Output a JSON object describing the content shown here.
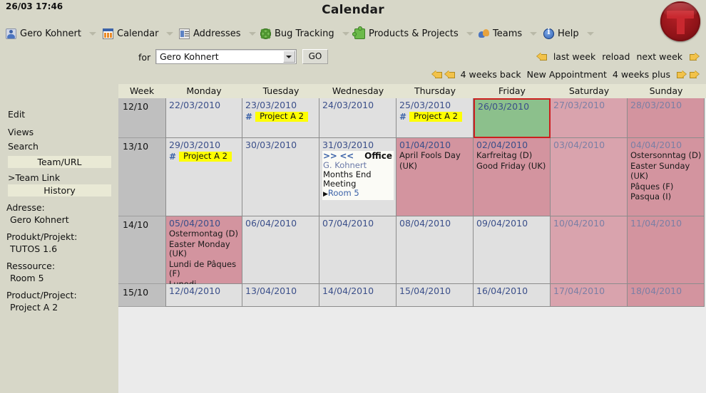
{
  "banner": {
    "clock": "26/03 17:46",
    "title": "Calendar",
    "logo_alt": "tutos-logo"
  },
  "menubar": [
    {
      "label": "Gero Kohnert",
      "icon": "user-icon"
    },
    {
      "label": "Calendar",
      "icon": "calendar-icon"
    },
    {
      "label": "Addresses",
      "icon": "addressbook-icon"
    },
    {
      "label": "Bug Tracking",
      "icon": "bug-icon"
    },
    {
      "label": "Products & Projects",
      "icon": "puzzle-icon"
    },
    {
      "label": "Teams",
      "icon": "team-icon"
    },
    {
      "label": "Help",
      "icon": "info-icon"
    }
  ],
  "sidebar": {
    "links": [
      "Edit",
      "Views",
      "Search"
    ],
    "team_bar": "Team/URL",
    "team_link": ">Team Link",
    "history_bar": "History",
    "fields": [
      {
        "key": "Adresse:",
        "value": "Gero Kohnert"
      },
      {
        "key": "Produkt/Projekt:",
        "value": "TUTOS 1.6"
      },
      {
        "key": "Ressource:",
        "value": "Room 5"
      },
      {
        "key": "Product/Project:",
        "value": "Project A 2"
      }
    ]
  },
  "toolbar": {
    "for_label": "for",
    "selected_user": "Gero Kohnert",
    "go_label": "GO",
    "nav_row1": [
      "last week",
      "reload",
      "next week"
    ],
    "nav_row2": [
      "4 weeks back",
      "New Appointment",
      "4 weeks plus"
    ]
  },
  "calendar": {
    "headers": [
      "Week",
      "Monday",
      "Tuesday",
      "Wednesday",
      "Thursday",
      "Friday",
      "Saturday",
      "Sunday"
    ],
    "colors": {
      "weekday": "#e0e0e0",
      "weekend": "#d3949f",
      "today": "#8cc08c",
      "today_border": "#cc1f1f",
      "project_tag": "#ffff00",
      "date_text": "#3b4f8a"
    },
    "rows": [
      {
        "week": "12/10",
        "days": [
          {
            "date": "22/03/2010",
            "type": "weekday",
            "projects": [],
            "holidays": [],
            "appt": null
          },
          {
            "date": "23/03/2010",
            "type": "weekday",
            "projects": [
              "Project A 2"
            ],
            "holidays": [],
            "appt": null
          },
          {
            "date": "24/03/2010",
            "type": "weekday",
            "projects": [],
            "holidays": [],
            "appt": null
          },
          {
            "date": "25/03/2010",
            "type": "weekday",
            "projects": [
              "Project A 2"
            ],
            "holidays": [],
            "appt": null
          },
          {
            "date": "26/03/2010",
            "type": "today",
            "projects": [],
            "holidays": [],
            "appt": null
          },
          {
            "date": "27/03/2010",
            "type": "weekend-lite",
            "projects": [],
            "holidays": [],
            "appt": null
          },
          {
            "date": "28/03/2010",
            "type": "weekend",
            "projects": [],
            "holidays": [],
            "appt": null
          }
        ]
      },
      {
        "week": "13/10",
        "days": [
          {
            "date": "29/03/2010",
            "type": "weekday",
            "projects": [
              "Project A 2"
            ],
            "holidays": [],
            "appt": null
          },
          {
            "date": "30/03/2010",
            "type": "weekday",
            "projects": [],
            "holidays": [],
            "appt": null
          },
          {
            "date": "31/03/2010",
            "type": "weekday",
            "projects": [],
            "holidays": [],
            "appt": {
              "marker_left": ">>",
              "marker_right": "<<",
              "location": "Office",
              "owner": "G. Kohnert",
              "title1": "Months End",
              "title2": "Meeting",
              "room": "Room 5"
            }
          },
          {
            "date": "01/04/2010",
            "type": "holiday",
            "projects": [],
            "holidays": [
              "April Fools Day",
              "(UK)"
            ],
            "appt": null
          },
          {
            "date": "02/04/2010",
            "type": "holiday",
            "projects": [],
            "holidays": [
              "Karfreitag (D)",
              "Good Friday (UK)"
            ],
            "appt": null
          },
          {
            "date": "03/04/2010",
            "type": "weekend-lite",
            "projects": [],
            "holidays": [],
            "appt": null
          },
          {
            "date": "04/04/2010",
            "type": "weekend",
            "projects": [],
            "holidays": [
              "Ostersonntag (D)",
              "Easter Sunday",
              "(UK)",
              "Pâques (F)",
              "Pasqua (I)"
            ],
            "appt": null
          }
        ]
      },
      {
        "week": "14/10",
        "days": [
          {
            "date": "05/04/2010",
            "type": "holiday",
            "projects": [],
            "holidays": [
              "Ostermontag (D)",
              "Easter Monday (UK)",
              "Lundi de Pâques (F)",
              "Lunedi dell'Angelo (I)"
            ],
            "appt": null
          },
          {
            "date": "06/04/2010",
            "type": "weekday",
            "projects": [],
            "holidays": [],
            "appt": null
          },
          {
            "date": "07/04/2010",
            "type": "weekday",
            "projects": [],
            "holidays": [],
            "appt": null
          },
          {
            "date": "08/04/2010",
            "type": "weekday",
            "projects": [],
            "holidays": [],
            "appt": null
          },
          {
            "date": "09/04/2010",
            "type": "weekday",
            "projects": [],
            "holidays": [],
            "appt": null
          },
          {
            "date": "10/04/2010",
            "type": "weekend-lite",
            "projects": [],
            "holidays": [],
            "appt": null
          },
          {
            "date": "11/04/2010",
            "type": "weekend",
            "projects": [],
            "holidays": [],
            "appt": null
          }
        ]
      },
      {
        "week": "15/10",
        "days": [
          {
            "date": "12/04/2010",
            "type": "weekday",
            "projects": [],
            "holidays": [],
            "appt": null
          },
          {
            "date": "13/04/2010",
            "type": "weekday",
            "projects": [],
            "holidays": [],
            "appt": null
          },
          {
            "date": "14/04/2010",
            "type": "weekday",
            "projects": [],
            "holidays": [],
            "appt": null
          },
          {
            "date": "15/04/2010",
            "type": "weekday",
            "projects": [],
            "holidays": [],
            "appt": null
          },
          {
            "date": "16/04/2010",
            "type": "weekday",
            "projects": [],
            "holidays": [],
            "appt": null
          },
          {
            "date": "17/04/2010",
            "type": "weekend-lite",
            "projects": [],
            "holidays": [],
            "appt": null
          },
          {
            "date": "18/04/2010",
            "type": "weekend",
            "projects": [],
            "holidays": [],
            "appt": null
          }
        ]
      }
    ]
  }
}
